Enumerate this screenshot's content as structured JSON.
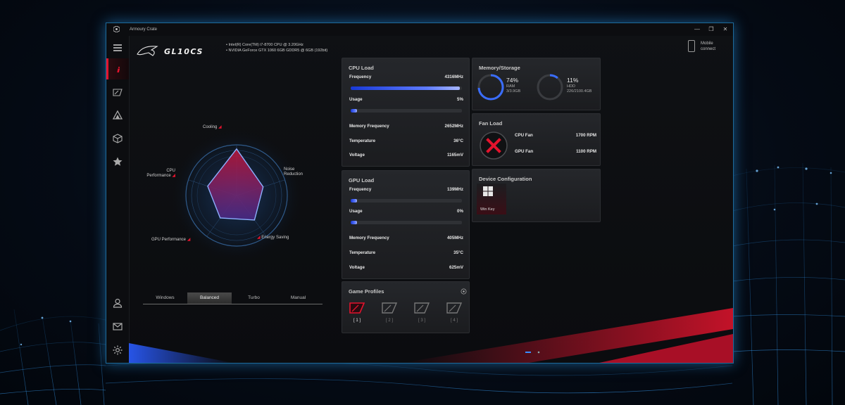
{
  "window": {
    "title": "Armoury Crate",
    "controls": [
      "—",
      "❐",
      "✕"
    ]
  },
  "sidebar": {
    "items": [
      {
        "name": "menu-icon"
      },
      {
        "name": "info-icon",
        "active": true
      },
      {
        "name": "game-profile-icon"
      },
      {
        "name": "aura-icon"
      },
      {
        "name": "cube-icon"
      },
      {
        "name": "star-icon"
      },
      {
        "name": "user-icon"
      },
      {
        "name": "mail-icon"
      },
      {
        "name": "settings-icon"
      }
    ]
  },
  "header": {
    "model": "GL10CS",
    "specs": [
      "Intel(R) Core(TM) i7-8700 CPU @ 3.20GHz",
      "NVIDIA GeForce GTX 1060 6GB GDDR5 @ 6GB (192bit)"
    ],
    "mobile_connect": "Mobile connect"
  },
  "radar": {
    "labels": {
      "cooling": "Cooling",
      "noise": "Noise Reduction",
      "noise_l1": "Noise",
      "noise_l2": "Reduction",
      "energy": "Energy Saving",
      "gpu": "GPU Performance",
      "cpu_l1": "CPU",
      "cpu_l2": "Performance"
    },
    "values": {
      "cooling": 0.92,
      "noise": 0.55,
      "energy": 0.6,
      "gpu": 0.55,
      "cpu": 0.6
    },
    "color_fill": "#d61f3e",
    "color_line": "#7da8ff"
  },
  "modes": {
    "items": [
      "Windows",
      "Balanced",
      "Turbo",
      "Manual"
    ],
    "selected": "Balanced"
  },
  "cpu": {
    "title": "CPU Load",
    "frequency_label": "Frequency",
    "frequency": "4316MHz",
    "frequency_level": 0.98,
    "usage_label": "Usage",
    "usage": "5%",
    "usage_level": 0.05,
    "memfreq_label": "Memory Frequency",
    "memfreq": "2652MHz",
    "temp_label": "Temperature",
    "temp": "36°C",
    "voltage_label": "Voltage",
    "voltage": "1165mV"
  },
  "gpu": {
    "title": "GPU Load",
    "frequency_label": "Frequency",
    "frequency": "139MHz",
    "frequency_level": 0.05,
    "usage_label": "Usage",
    "usage": "0%",
    "usage_level": 0.0,
    "memfreq_label": "Memory Frequency",
    "memfreq": "405MHz",
    "temp_label": "Temperature",
    "temp": "35°C",
    "voltage_label": "Voltage",
    "voltage": "625mV"
  },
  "memory": {
    "title": "Memory/Storage",
    "ram": {
      "pct": "74%",
      "label": "RAM",
      "detail": "3/3.9GB",
      "level": 0.74
    },
    "hdd": {
      "pct": "11%",
      "label": "HDD",
      "detail": "226/2100.4GB",
      "level": 0.11
    }
  },
  "fan": {
    "title": "Fan Load",
    "cpu_label": "CPU Fan",
    "cpu_value": "1700  RPM",
    "gpu_label": "GPU Fan",
    "gpu_value": "1100  RPM"
  },
  "device": {
    "title": "Device Configuration",
    "winkey_label": "Win Key"
  },
  "profiles": {
    "title": "Game Profiles",
    "items": [
      "[ 1 ]",
      "[ 2 ]",
      "[ 3 ]",
      "[ 4 ]"
    ],
    "selected": 0
  },
  "colors": {
    "accent_red": "#e3132d",
    "accent_blue": "#2a5cff",
    "window_border": "#1d6a9a"
  }
}
